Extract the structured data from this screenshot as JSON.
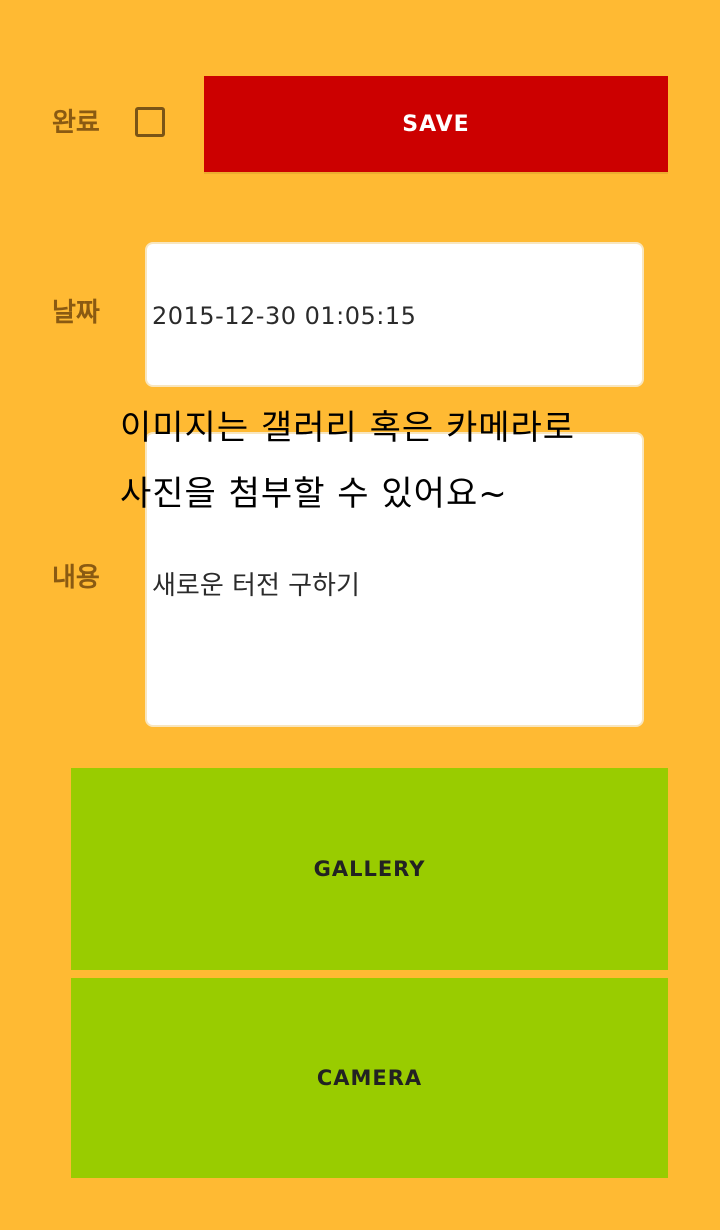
{
  "form": {
    "done_label": "완료",
    "save_label": "SAVE",
    "date_label": "날짜",
    "date_value": "2015-12-30 01:05:15",
    "content_label": "내용",
    "content_value": "새로운 터전 구하기",
    "hint_line_1": "이미지는 갤러리 혹은 카메라로",
    "hint_line_2": "사진을 첨부할 수 있어요~",
    "gallery_label": "GALLERY",
    "camera_label": "CAMERA"
  },
  "colors": {
    "background": "#FFBA33",
    "save_button": "#CC0000",
    "action_button": "#99CC00",
    "label_text": "#8A5A12",
    "field_background": "#FFFFFF"
  },
  "checkbox": {
    "checked": false
  }
}
